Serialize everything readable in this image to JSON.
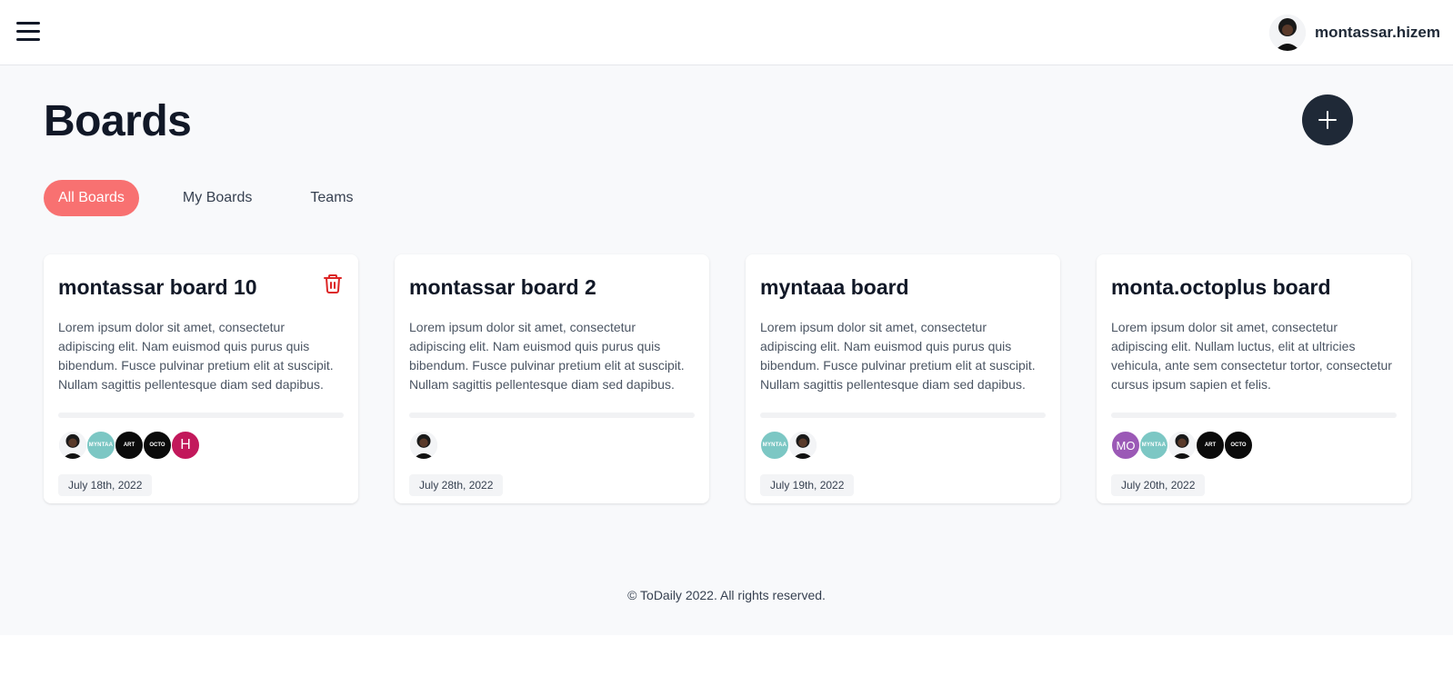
{
  "header": {
    "menu_icon": "hamburger-menu-icon",
    "username": "montassar.hizem"
  },
  "page": {
    "title": "Boards",
    "add_icon": "plus-icon"
  },
  "tabs": [
    {
      "label": "All Boards",
      "active": true
    },
    {
      "label": "My Boards",
      "active": false
    },
    {
      "label": "Teams",
      "active": false
    }
  ],
  "boards": [
    {
      "title": "montassar board 10",
      "deletable": true,
      "description": "Lorem ipsum dolor sit amet, consectetur adipiscing elit. Nam euismod quis purus quis bibendum. Fusce pulvinar pretium elit at suscipit. Nullam sagittis pellentesque diam sed dapibus.",
      "members": [
        {
          "type": "photo"
        },
        {
          "type": "myntaa",
          "text": "MYNTAA"
        },
        {
          "type": "dark",
          "text": "ART"
        },
        {
          "type": "dark",
          "text": "OCTO"
        },
        {
          "type": "letter",
          "text": "H",
          "color": "#c2185b"
        }
      ],
      "date": "July 18th, 2022"
    },
    {
      "title": "montassar board 2",
      "deletable": false,
      "description": "Lorem ipsum dolor sit amet, consectetur adipiscing elit. Nam euismod quis purus quis bibendum. Fusce pulvinar pretium elit at suscipit. Nullam sagittis pellentesque diam sed dapibus.",
      "members": [
        {
          "type": "photo"
        }
      ],
      "date": "July 28th, 2022"
    },
    {
      "title": "myntaaa board",
      "deletable": false,
      "description": "Lorem ipsum dolor sit amet, consectetur adipiscing elit. Nam euismod quis purus quis bibendum. Fusce pulvinar pretium elit at suscipit. Nullam sagittis pellentesque diam sed dapibus.",
      "members": [
        {
          "type": "myntaa",
          "text": "MYNTAA"
        },
        {
          "type": "photo"
        }
      ],
      "date": "July 19th, 2022"
    },
    {
      "title": "monta.octoplus board",
      "deletable": false,
      "description": "Lorem ipsum dolor sit amet, consectetur adipiscing elit. Nullam luctus, elit at ultricies vehicula, ante sem consectetur tortor, consectetur cursus ipsum sapien et felis.",
      "members": [
        {
          "type": "letter",
          "text": "MO",
          "color": "#9b59b6"
        },
        {
          "type": "myntaa",
          "text": "MYNTAA"
        },
        {
          "type": "photo"
        },
        {
          "type": "dark",
          "text": "ART"
        },
        {
          "type": "dark",
          "text": "OCTO"
        }
      ],
      "date": "July 20th, 2022"
    }
  ],
  "footer": {
    "text": "© ToDaily 2022. All rights reserved."
  },
  "colors": {
    "accent": "#f87171",
    "dark": "#1f2937",
    "danger": "#dc2626",
    "background": "#f8f9fb"
  }
}
